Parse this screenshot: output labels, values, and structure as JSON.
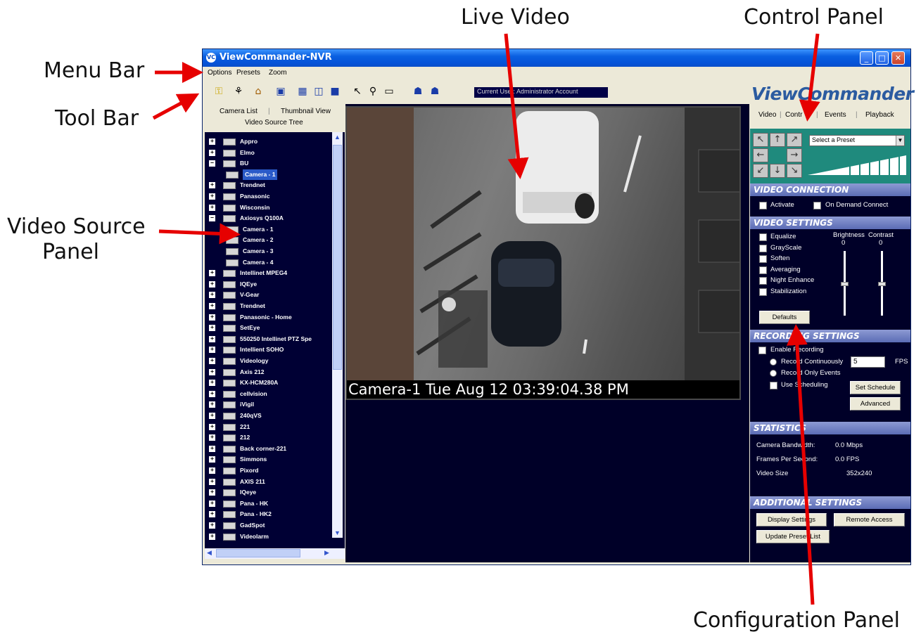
{
  "annotations": {
    "menu_bar": "Menu Bar",
    "tool_bar": "Tool Bar",
    "video_source_panel_line1": "Video Source",
    "video_source_panel_line2": "Panel",
    "live_video": "Live Video",
    "control_panel": "Control Panel",
    "configuration_panel": "Configuration Panel"
  },
  "window": {
    "title": "ViewCommander-NVR",
    "icon_text": "VC"
  },
  "menu": [
    "Options",
    "Presets",
    "Zoom"
  ],
  "toolbar": {
    "current_user": "Current User: Administrator Account",
    "logo": "ViewCommander"
  },
  "left_tabs": {
    "camera_list": "Camera List",
    "thumbnail_view": "Thumbnail View",
    "video_source_tree": "Video Source Tree"
  },
  "tree": [
    {
      "label": "Appro",
      "level": 0
    },
    {
      "label": "Elmo",
      "level": 0
    },
    {
      "label": "BU",
      "level": 0,
      "expanded": true
    },
    {
      "label": "Camera - 1",
      "level": 1,
      "selected": true
    },
    {
      "label": "Trendnet",
      "level": 0
    },
    {
      "label": "Panasonic",
      "level": 0
    },
    {
      "label": "Wisconsin",
      "level": 0
    },
    {
      "label": "Axiosys Q100A",
      "level": 0,
      "expanded": true
    },
    {
      "label": "Camera - 1",
      "level": 1
    },
    {
      "label": "Camera - 2",
      "level": 1
    },
    {
      "label": "Camera - 3",
      "level": 1
    },
    {
      "label": "Camera - 4",
      "level": 1
    },
    {
      "label": "Intellinet MPEG4",
      "level": 0
    },
    {
      "label": "IQEye",
      "level": 0
    },
    {
      "label": "V-Gear",
      "level": 0
    },
    {
      "label": "Trendnet",
      "level": 0
    },
    {
      "label": "Panasonic - Home",
      "level": 0
    },
    {
      "label": "SetEye",
      "level": 0
    },
    {
      "label": "550250 Intellinet PTZ Spe",
      "level": 0
    },
    {
      "label": "Intellient SOHO",
      "level": 0
    },
    {
      "label": "Videology",
      "level": 0
    },
    {
      "label": "Axis 212",
      "level": 0
    },
    {
      "label": "KX-HCM280A",
      "level": 0
    },
    {
      "label": "cellvision",
      "level": 0
    },
    {
      "label": "iVigil",
      "level": 0
    },
    {
      "label": "240qVS",
      "level": 0
    },
    {
      "label": "221",
      "level": 0
    },
    {
      "label": "212",
      "level": 0
    },
    {
      "label": "Back corner-221",
      "level": 0
    },
    {
      "label": "Simmons",
      "level": 0
    },
    {
      "label": "Pixord",
      "level": 0
    },
    {
      "label": "AXIS 211",
      "level": 0
    },
    {
      "label": "IQeye",
      "level": 0
    },
    {
      "label": "Pana - HK",
      "level": 0
    },
    {
      "label": "Pana - HK2",
      "level": 0
    },
    {
      "label": "GadSpot",
      "level": 0
    },
    {
      "label": "Videolarm",
      "level": 0
    }
  ],
  "video": {
    "caption": "Camera-1 Tue Aug 12 03:39:04.38 PM"
  },
  "right_tabs": [
    "Video",
    "Contr",
    "Events",
    "Playback"
  ],
  "ptz": {
    "preset_placeholder": "Select a Preset"
  },
  "video_connection": {
    "header": "VIDEO CONNECTION",
    "activate": "Activate",
    "on_demand": "On Demand Connect"
  },
  "video_settings": {
    "header": "VIDEO SETTINGS",
    "options": [
      "Equalize",
      "GrayScale",
      "Soften",
      "Averaging",
      "Night Enhance",
      "Stabilization"
    ],
    "brightness_label": "Brightness",
    "brightness_value": "0",
    "contrast_label": "Contrast",
    "contrast_value": "0",
    "defaults_button": "Defaults"
  },
  "recording_settings": {
    "header": "RECORDING SETTINGS",
    "enable": "Enable Recording",
    "record_continuously": "Record Continuously",
    "fps_value": "5",
    "fps_label": "FPS",
    "record_events": "Record Only Events",
    "use_scheduling": "Use Scheduling",
    "set_schedule": "Set Schedule",
    "advanced": "Advanced"
  },
  "statistics": {
    "header": "STATISTICS",
    "rows": [
      {
        "label": "Camera Bandwidth:",
        "value": "0.0 Mbps"
      },
      {
        "label": "Frames Per Second:",
        "value": "0.0 FPS"
      },
      {
        "label": "Video Size",
        "value": "352x240"
      }
    ]
  },
  "additional_settings": {
    "header": "ADDITIONAL SETTINGS",
    "display_settings": "Display Settings",
    "remote_access": "Remote Access",
    "update_preset_list": "Update Preset List"
  }
}
